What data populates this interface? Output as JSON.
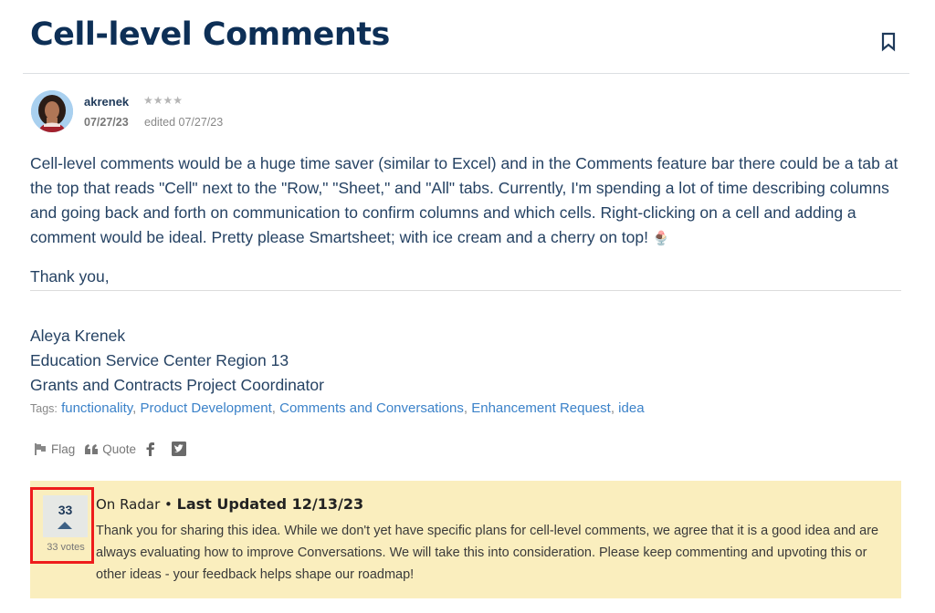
{
  "page": {
    "title": "Cell-level Comments",
    "bookmark_icon": "bookmark-icon"
  },
  "post": {
    "author": {
      "username": "akrenek",
      "rank_stars": "★★★★",
      "avatar_icon": "user-avatar"
    },
    "date": "07/27/23",
    "edited": "edited 07/27/23",
    "body": "Cell-level comments would be a huge time saver (similar to Excel) and in the Comments feature bar there could be a tab at the top that reads \"Cell\" next to the \"Row,\" \"Sheet,\" and \"All\" tabs. Currently, I'm spending a lot of time describing columns and going back and forth on communication to confirm columns and which cells. Right-clicking on a cell and adding a comment would be ideal. Pretty please Smartsheet; with ice cream and a cherry on top! ",
    "body_emoji": "🍨",
    "thanks": "Thank you,",
    "signature": [
      "Aleya Krenek",
      "Education Service Center Region 13",
      "Grants and Contracts Project Coordinator"
    ],
    "tags_label": "Tags:",
    "tags": [
      "functionality",
      "Product Development",
      "Comments and Conversations",
      "Enhancement Request",
      "idea"
    ],
    "actions": {
      "flag": "Flag",
      "quote": "Quote",
      "facebook_icon": "facebook-icon",
      "twitter_icon": "twitter-icon"
    }
  },
  "status": {
    "votes": "33",
    "votes_label": "33 votes",
    "state": "On Radar",
    "separator": " • ",
    "last_updated": "Last Updated 12/13/23",
    "message": "Thank you for sharing this idea. While we don't yet have specific plans for cell-level comments, we agree that it is a good idea and are always evaluating how to improve Conversations. We will take this into consideration. Please keep commenting and upvoting this or other ideas - your feedback helps shape our roadmap!"
  },
  "colors": {
    "title": "#0d2f56",
    "body_text": "#254263",
    "link": "#3b82c9",
    "status_bg": "#faeebe",
    "highlight": "#ee1c1c"
  }
}
